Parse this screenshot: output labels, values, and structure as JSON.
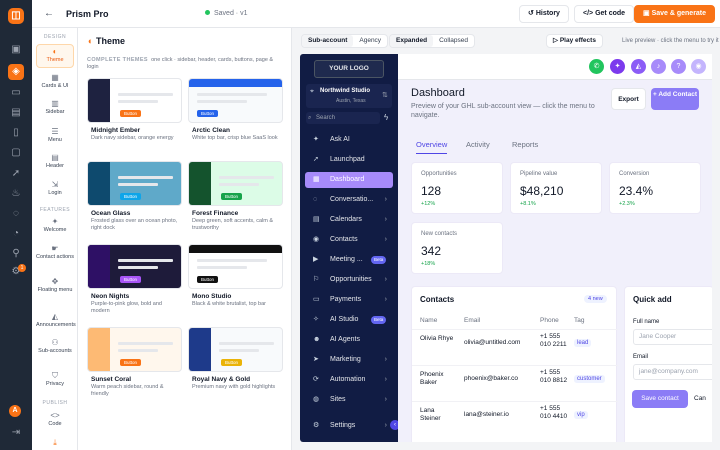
{
  "rail": {
    "logo_glyph": "◫",
    "icons": [
      "grid-icon",
      "layers-icon",
      "card-icon",
      "calendar-icon",
      "doc-icon",
      "clipboard-icon",
      "rocket-icon",
      "flame-icon",
      "chat-icon",
      "gauge-icon",
      "link-icon",
      "settings-icon"
    ],
    "badge": "1",
    "avatar": "A"
  },
  "topbar": {
    "back_glyph": "←",
    "title": "Prism Pro",
    "saved": "Saved · v1",
    "history": "History",
    "get_code": "Get code",
    "save_generate": "Save & generate"
  },
  "tabs": {
    "design_head": "DESIGN",
    "features_head": "FEATURES",
    "publish_head": "PUBLISH",
    "theme": "Theme",
    "cards": "Cards & UI",
    "sidebar": "Sidebar",
    "menu": "Menu",
    "header": "Header",
    "login": "Login",
    "welcome": "Welcome",
    "contact_actions": "Contact actions",
    "floating_menu": "Floating menu",
    "announcements": "Announcements",
    "sub_accounts": "Sub-accounts",
    "privacy": "Privacy",
    "code": "Code"
  },
  "panel": {
    "title": "Theme",
    "sub_head": "COMPLETE THEMES",
    "sub_text": "one click · sidebar, header, cards, buttons, page & login",
    "button_label": "Button",
    "themes": [
      {
        "name": "Midnight Ember",
        "desc": "Dark navy sidebar, orange energy",
        "bar": "#1e2240",
        "accent": "#f97316",
        "bg": "#ffffff"
      },
      {
        "name": "Arctic Clean",
        "desc": "White top bar, crisp blue SaaS look",
        "bar": "#ffffff",
        "accent": "#2563eb",
        "bg": "#f8fafc"
      },
      {
        "name": "Ocean Glass",
        "desc": "Frosted glass over an ocean photo, right dock",
        "bar": "#0e4a6e",
        "accent": "#0ea5e9",
        "bg": "#5fa9c9"
      },
      {
        "name": "Forest Finance",
        "desc": "Deep green, soft accents, calm & trustworthy",
        "bar": "#14532d",
        "accent": "#16a34a",
        "bg": "#dcfce7"
      },
      {
        "name": "Neon Nights",
        "desc": "Purple-to-pink glow, bold and modern",
        "bar": "#2e1065",
        "accent": "#a855f7",
        "bg": "#1e1b3a"
      },
      {
        "name": "Mono Studio",
        "desc": "Black & white brutalist, top bar",
        "bar": "#ffffff",
        "accent": "#111111",
        "bg": "#ffffff"
      },
      {
        "name": "Sunset Coral",
        "desc": "Warm peach sidebar, round & friendly",
        "bar": "#fdba74",
        "accent": "#f97316",
        "bg": "#fff7ed"
      },
      {
        "name": "Royal Navy & Gold",
        "desc": "Premium navy with gold highlights",
        "bar": "#1e3a8a",
        "accent": "#eab308",
        "bg": "#f8fafc"
      }
    ]
  },
  "preview": {
    "subaccount": "Sub-account",
    "agency": "Agency",
    "expanded": "Expanded",
    "collapsed": "Collapsed",
    "play_effects": "Play effects",
    "live_note": "Live preview · click the menu to try it"
  },
  "mock_sidebar": {
    "logo": "YOUR LOGO",
    "org_name": "Northwind Studio",
    "org_loc": "Austin, Texas",
    "search": "Search",
    "items": [
      {
        "label": "Ask AI",
        "icon": "✦",
        "chev": "",
        "beta": ""
      },
      {
        "label": "Launchpad",
        "icon": "➚",
        "chev": "",
        "beta": ""
      },
      {
        "label": "Dashboard",
        "icon": "▦",
        "chev": "",
        "beta": "",
        "active": true
      },
      {
        "label": "Conversatio...",
        "icon": "◌",
        "chev": "›",
        "beta": ""
      },
      {
        "label": "Calendars",
        "icon": "▤",
        "chev": "›",
        "beta": ""
      },
      {
        "label": "Contacts",
        "icon": "◉",
        "chev": "›",
        "beta": ""
      },
      {
        "label": "Meeting ...",
        "icon": "▶",
        "chev": "",
        "beta": "Beta"
      },
      {
        "label": "Opportunities",
        "icon": "⚐",
        "chev": "›",
        "beta": ""
      },
      {
        "label": "Payments",
        "icon": "▭",
        "chev": "›",
        "beta": ""
      },
      {
        "label": "AI Studio",
        "icon": "✧",
        "chev": "",
        "beta": "Beta"
      },
      {
        "label": "AI Agents",
        "icon": "☻",
        "chev": "",
        "beta": ""
      },
      {
        "label": "Marketing",
        "icon": "➤",
        "chev": "›",
        "beta": ""
      },
      {
        "label": "Automation",
        "icon": "⟳",
        "chev": "›",
        "beta": ""
      },
      {
        "label": "Sites",
        "icon": "◍",
        "chev": "›",
        "beta": ""
      },
      {
        "label": "Settings",
        "icon": "⚙",
        "chev": "›",
        "beta": ""
      }
    ]
  },
  "mock_main": {
    "title": "Dashboard",
    "desc": "Preview of your GHL sub-account view — click the menu to navigate.",
    "export": "Export",
    "add_contact": "+ Add Contact",
    "tabs": [
      "Overview",
      "Activity",
      "Reports"
    ],
    "kpis": [
      {
        "label": "Opportunities",
        "value": "128",
        "delta": "+12%"
      },
      {
        "label": "Pipeline value",
        "value": "$48,210",
        "delta": "+8.1%"
      },
      {
        "label": "Conversion",
        "value": "23.4%",
        "delta": "+2.3%"
      },
      {
        "label": "New contacts",
        "value": "342",
        "delta": "+18%"
      }
    ],
    "contacts": {
      "title": "Contacts",
      "new_badge": "4 new",
      "headers": [
        "Name",
        "Email",
        "Phone",
        "Tag"
      ],
      "rows": [
        {
          "name": "Olivia Rhye",
          "email": "olivia@untitled.com",
          "phone": "+1 555 010 2211",
          "tag": "lead"
        },
        {
          "name": "Phoenix Baker",
          "email": "phoenix@baker.co",
          "phone": "+1 555 010 8812",
          "tag": "customer"
        },
        {
          "name": "Lana Steiner",
          "email": "lana@steiner.io",
          "phone": "+1 555 010 4410",
          "tag": "vip"
        }
      ]
    },
    "quick_add": {
      "title": "Quick add",
      "full_name_label": "Full name",
      "full_name_ph": "Jane Cooper",
      "email_label": "Email",
      "email_ph": "jane@company.com",
      "save": "Save contact",
      "cancel": "Can"
    }
  }
}
